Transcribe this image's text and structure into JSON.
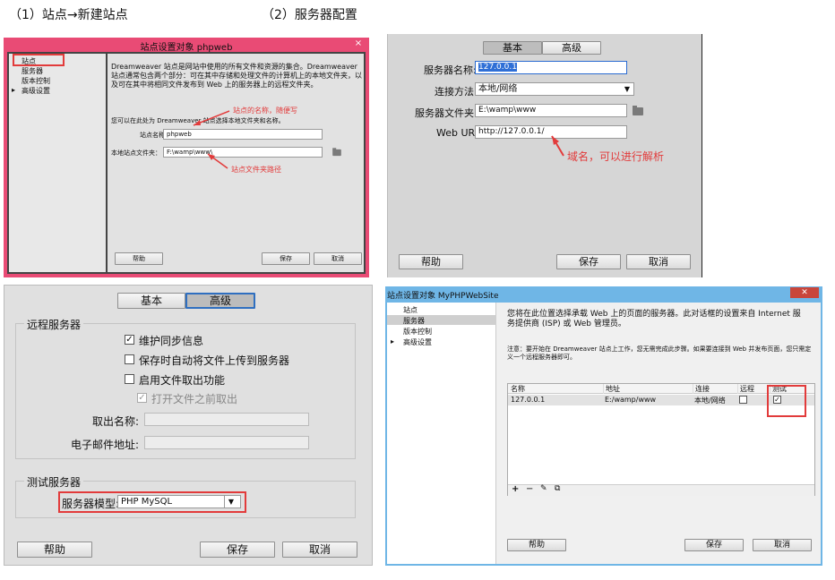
{
  "captions": {
    "caption1": "（1）站点→新建站点",
    "caption2": "（2）服务器配置"
  },
  "p1": {
    "title": "站点设置对象 phpweb",
    "close": "×",
    "sidebar": [
      "站点",
      "服务器",
      "版本控制",
      "高级设置"
    ],
    "desc": "Dreamweaver 站点是网站中使用的所有文件和资源的集合。Dreamweaver 站点通常包含两个部分：可在其中存储和处理文件的计算机上的本地文件夹，以及可在其中将相同文件发布到 Web 上的服务器上的远程文件夹。",
    "hint": "您可以在此处为 Dreamweaver 站点选择本地文件夹和名称。",
    "site_name_label": "站点名称：",
    "site_name_value": "phpweb",
    "local_folder_label": "本地站点文件夹：",
    "local_folder_value": "F:\\wamp\\www\\",
    "annot_name": "站点的名称，随便写",
    "annot_folder": "站点文件夹路径",
    "help": "帮助",
    "save": "保存",
    "cancel": "取消"
  },
  "p2": {
    "tab_basic": "基本",
    "tab_adv": "高级",
    "server_name_label": "服务器名称:",
    "server_name_value": "127.0.0.1",
    "connect_label": "连接方法:",
    "connect_value": "本地/网络",
    "server_folder_label": "服务器文件夹:",
    "server_folder_value": "E:\\wamp\\www",
    "weburl_label": "Web URL:",
    "weburl_value": "http://127.0.0.1/",
    "annot_domain": "域名，可以进行解析",
    "help": "帮助",
    "save": "保存",
    "cancel": "取消"
  },
  "p3": {
    "tab_basic": "基本",
    "tab_adv": "高级",
    "remote_group": "远程服务器",
    "opt_sync": "维护同步信息",
    "opt_autoupload": "保存时自动将文件上传到服务器",
    "opt_checkout": "启用文件取出功能",
    "opt_opencheckout": "打开文件之前取出",
    "checkout_name_label": "取出名称:",
    "email_label": "电子邮件地址:",
    "test_group": "测试服务器",
    "server_model_label": "服务器模型:",
    "server_model_value": "PHP MySQL",
    "help": "帮助",
    "save": "保存",
    "cancel": "取消"
  },
  "p4": {
    "title": "站点设置对象 MyPHPWebSite",
    "close": "✕",
    "sidebar": [
      "站点",
      "服务器",
      "版本控制",
      "高级设置"
    ],
    "desc": "您将在此位置选择承载 Web 上的页面的服务器。此对话框的设置来自 Internet 服务提供商 (ISP) 或 Web 管理员。",
    "note": "注意：要开始在 Dreamweaver 站点上工作，您无需完成此步骤。如果要连接到 Web 并发布页面，您只需定义一个远程服务器即可。",
    "columns": [
      "名称",
      "地址",
      "连接",
      "远程",
      "测试"
    ],
    "row": {
      "name": "127.0.0.1",
      "address": "E:/wamp/www",
      "connection": "本地/网络",
      "remote_checked": false,
      "test_checked": true
    },
    "toolbar": [
      "+",
      "−",
      "✎",
      "⧉"
    ],
    "help": "帮助",
    "save": "保存",
    "cancel": "取消"
  }
}
